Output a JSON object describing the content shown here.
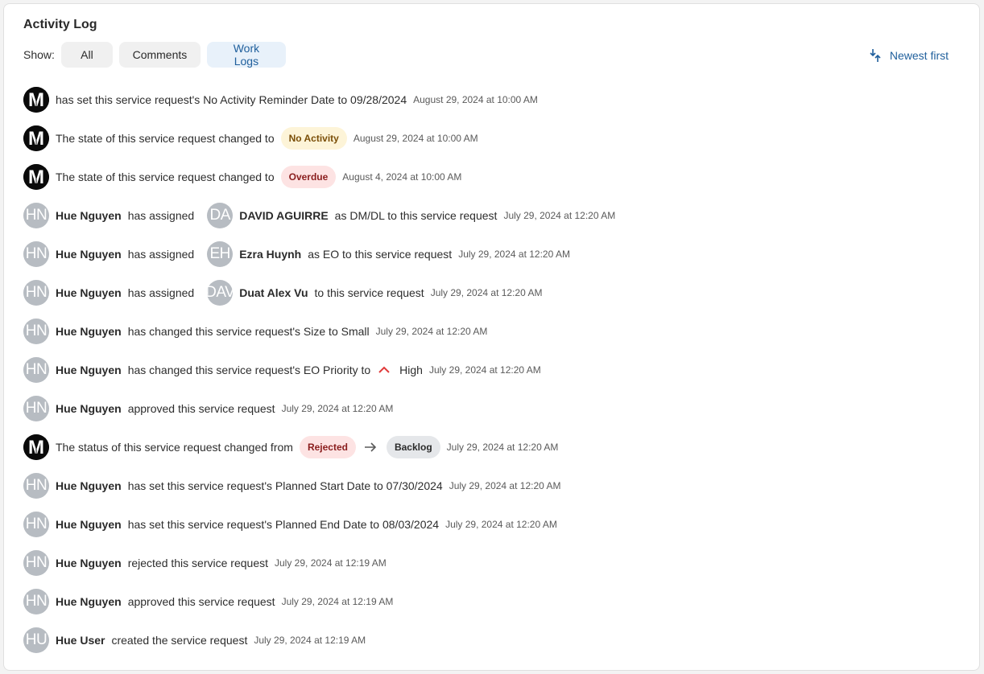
{
  "title": "Activity Log",
  "filter": {
    "show_label": "Show:",
    "all": "All",
    "comments": "Comments",
    "work_logs": "Work Logs",
    "active": "Work Logs"
  },
  "sort": {
    "label": "Newest first",
    "icon": "sort-arrows-icon"
  },
  "colors": {
    "accent": "#1f5f9c",
    "avatar_gray": "#b7bcc2",
    "no_activity_bg": "#fdf4d8",
    "overdue_bg": "#fde3e3",
    "backlog_bg": "#e5e7ea",
    "priority_high": "#e03a3a"
  },
  "entries": [
    {
      "text": "has set this service request's No Activity Reminder Date to 09/28/2024",
      "ts": "August 29, 2024 at 10:00 AM"
    },
    {
      "text": "The state of this service request changed to",
      "badge": "No Activity",
      "ts": "August 29, 2024 at 10:00 AM"
    },
    {
      "text": "The state of this service request changed to",
      "badge": "Overdue",
      "ts": "August 4, 2024 at 10:00 AM"
    },
    {
      "avatar": "HN",
      "name": "Hue Nguyen",
      "text": "has assigned",
      "assignee_avatar": "DA",
      "assignee": "DAVID AGUIRRE",
      "text2": "as DM/DL to this service request",
      "ts": "July 29, 2024 at 12:20 AM"
    },
    {
      "avatar": "HN",
      "name": "Hue Nguyen",
      "text": "has assigned",
      "assignee_avatar": "EH",
      "assignee": "Ezra Huynh",
      "text2": "as EO to this service request",
      "ts": "July 29, 2024 at 12:20 AM"
    },
    {
      "avatar": "HN",
      "name": "Hue Nguyen",
      "text": "has assigned",
      "assignee_avatar": "DAV",
      "assignee": "Duat Alex Vu",
      "text2": "to this service request",
      "ts": "July 29, 2024 at 12:20 AM"
    },
    {
      "avatar": "HN",
      "name": "Hue Nguyen",
      "text": "has changed this service request's Size to Small",
      "ts": "July 29, 2024 at 12:20 AM"
    },
    {
      "avatar": "HN",
      "name": "Hue Nguyen",
      "text": "has changed this service request's EO Priority to",
      "priority": "High",
      "ts": "July 29, 2024 at 12:20 AM"
    },
    {
      "avatar": "HN",
      "name": "Hue Nguyen",
      "text": "approved this service request",
      "ts": "July 29, 2024 at 12:20 AM"
    },
    {
      "text": "The status of this service request changed from",
      "from": "Rejected",
      "to": "Backlog",
      "ts": "July 29, 2024 at 12:20 AM"
    },
    {
      "avatar": "HN",
      "name": "Hue Nguyen",
      "text": "has set this service request's Planned Start Date to 07/30/2024",
      "ts": "July 29, 2024 at 12:20 AM"
    },
    {
      "avatar": "HN",
      "name": "Hue Nguyen",
      "text": "has set this service request's Planned End Date to 08/03/2024",
      "ts": "July 29, 2024 at 12:20 AM"
    },
    {
      "avatar": "HN",
      "name": "Hue Nguyen",
      "text": "rejected this service request",
      "ts": "July 29, 2024 at 12:19 AM"
    },
    {
      "avatar": "HN",
      "name": "Hue Nguyen",
      "text": "approved this service request",
      "ts": "July 29, 2024 at 12:19 AM"
    },
    {
      "avatar": "HU",
      "name": "Hue User",
      "text": "created the service request",
      "ts": "July 29, 2024 at 12:19 AM"
    }
  ]
}
